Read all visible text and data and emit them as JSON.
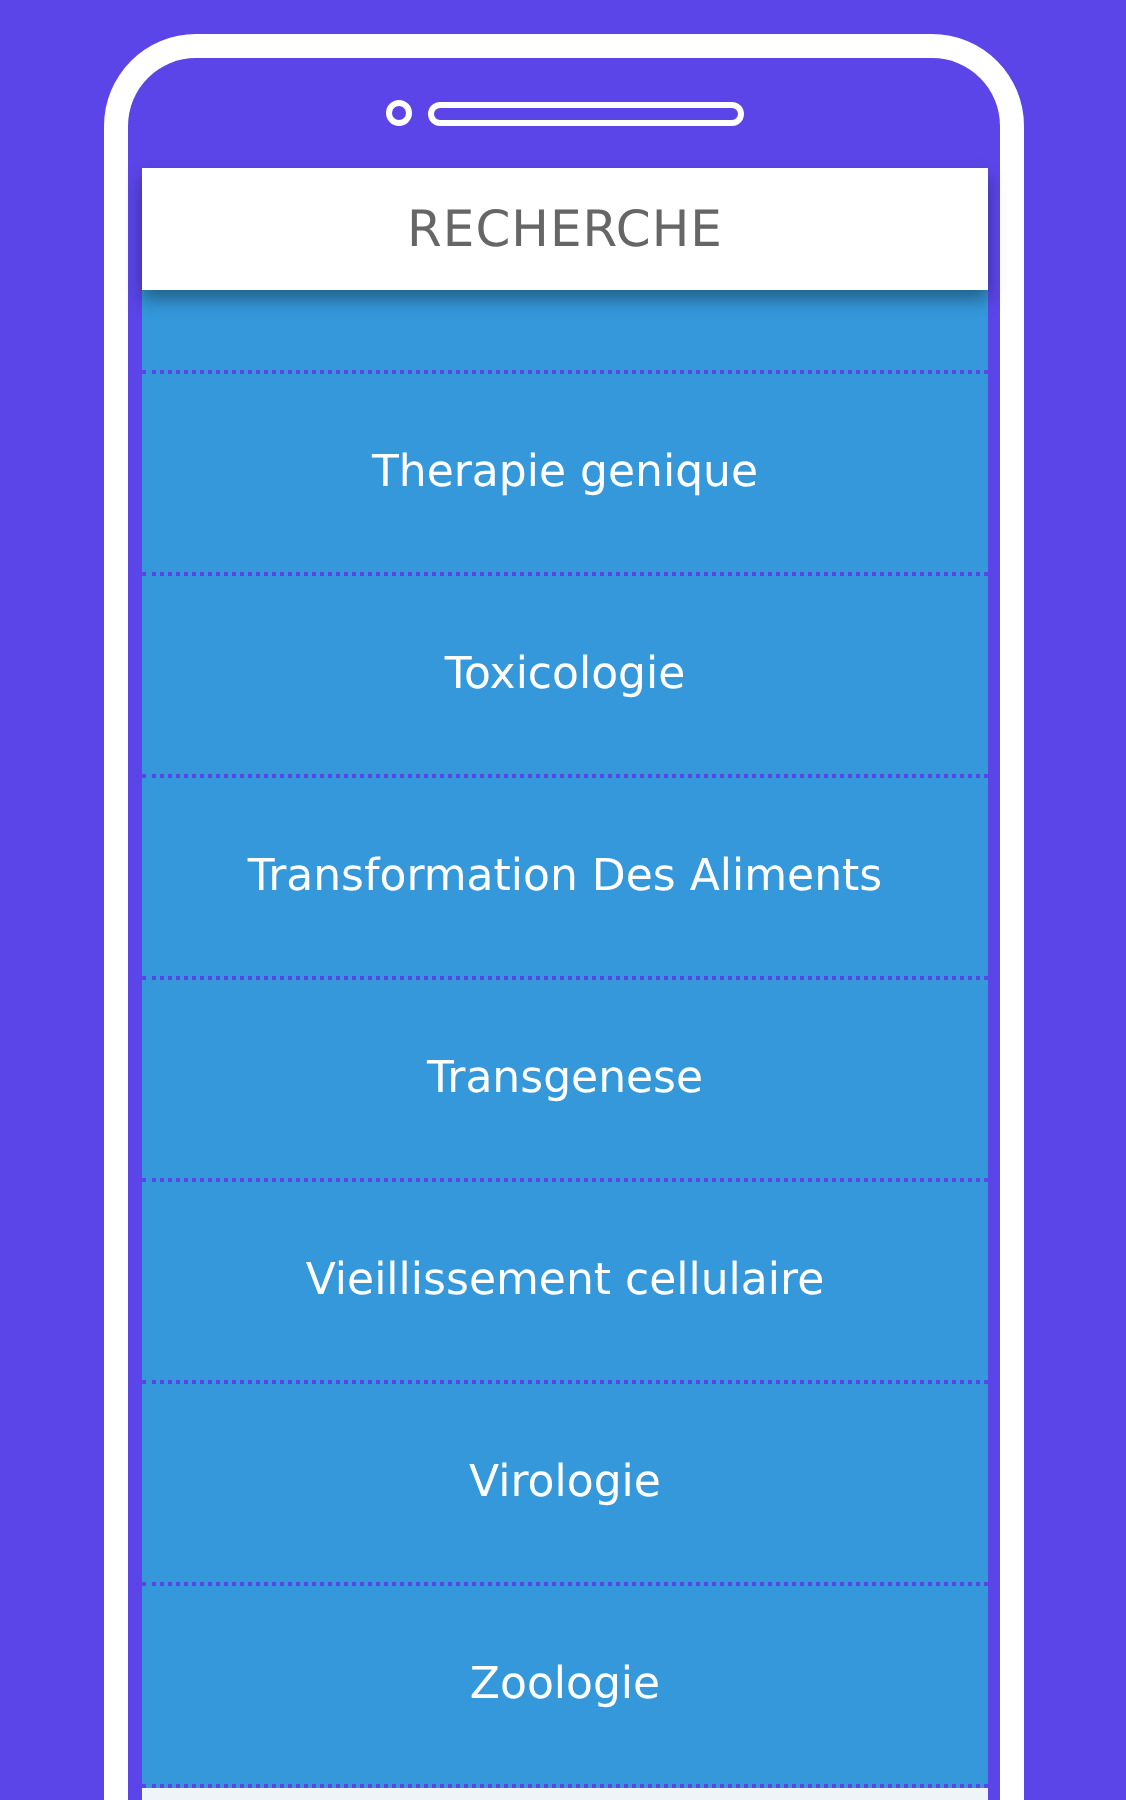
{
  "header": {
    "title": "RECHERCHE"
  },
  "list": [
    {
      "label": "Therapie genique"
    },
    {
      "label": "Toxicologie"
    },
    {
      "label": "Transformation Des Aliments"
    },
    {
      "label": "Transgenese"
    },
    {
      "label": "Vieillissement cellulaire"
    },
    {
      "label": "Virologie"
    },
    {
      "label": "Zoologie"
    }
  ]
}
